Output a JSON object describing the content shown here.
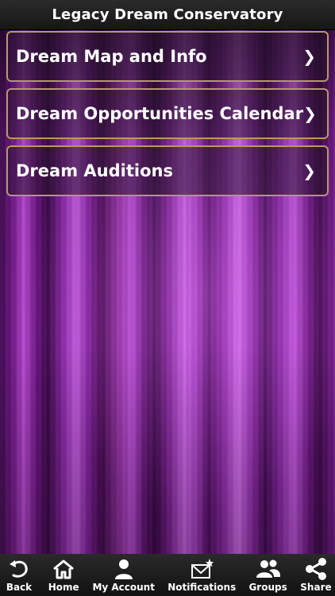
{
  "header": {
    "title": "Legacy Dream Conservatory"
  },
  "menu": {
    "items": [
      {
        "label": "Dream Map and Info",
        "chevron": "❯"
      },
      {
        "label": "Dream Opportunities Calendar",
        "chevron": "❯"
      },
      {
        "label": "Dream Auditions",
        "chevron": "❯"
      }
    ]
  },
  "tabbar": {
    "items": [
      {
        "label": "Back",
        "icon": "back-arrow-icon"
      },
      {
        "label": "Home",
        "icon": "home-icon"
      },
      {
        "label": "My Account",
        "icon": "user-icon"
      },
      {
        "label": "Notifications",
        "icon": "notification-icon"
      },
      {
        "label": "Groups",
        "icon": "groups-icon"
      },
      {
        "label": "Share",
        "icon": "share-icon"
      }
    ]
  },
  "colors": {
    "curtain": "#8a28a6",
    "border": "#b69a63",
    "bar": "#1d1d1d"
  }
}
